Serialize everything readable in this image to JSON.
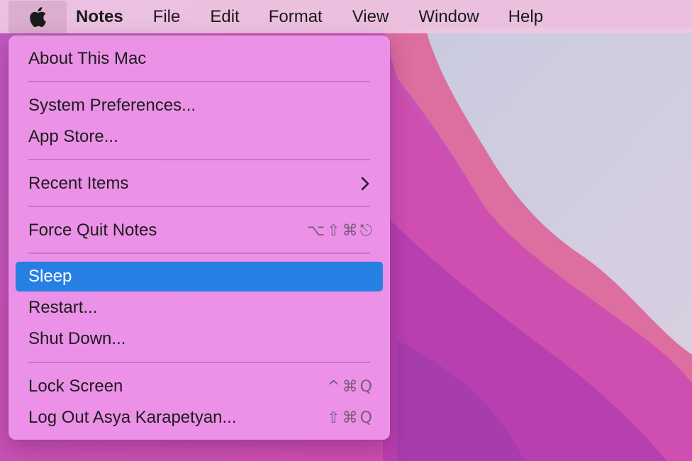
{
  "menubar": {
    "apple_icon": "apple-logo-icon",
    "app_name": "Notes",
    "items": [
      "File",
      "Edit",
      "Format",
      "View",
      "Window",
      "Help"
    ]
  },
  "apple_menu": {
    "about": "About This Mac",
    "system_preferences": "System Preferences...",
    "app_store": "App Store...",
    "recent_items": "Recent Items",
    "recent_items_icon": "chevron-right-icon",
    "force_quit": "Force Quit Notes",
    "force_quit_shortcut": "⌥⇧⌘⎋",
    "sleep": "Sleep",
    "restart": "Restart...",
    "shut_down": "Shut Down...",
    "lock_screen": "Lock Screen",
    "lock_screen_shortcut": "^⌘Q",
    "log_out": "Log Out Asya Karapetyan...",
    "log_out_shortcut": "⇧⌘Q"
  },
  "colors": {
    "menu_background": "#ec94e8",
    "highlight": "#2680e3",
    "menubar": "#eec8e2"
  }
}
